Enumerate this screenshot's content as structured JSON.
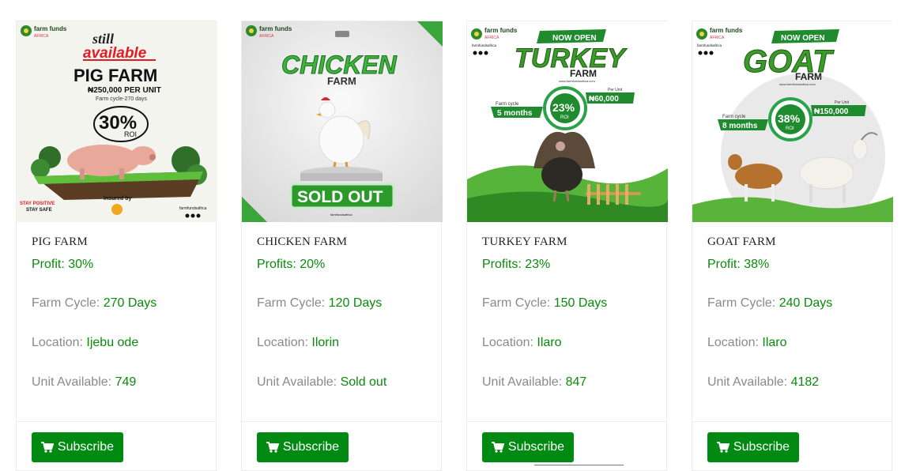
{
  "cards": [
    {
      "title": "PIG FARM",
      "profit": "Profit: 30%",
      "cycle_label": "Farm Cycle:",
      "cycle_value": "270 Days",
      "location_label": "Location:",
      "location_value": "Ijebu ode",
      "unit_label": "Unit Available:",
      "unit_value": "749",
      "button": "Subscribe",
      "banner": {
        "brand": "farm funds",
        "brand_sub": "AFRICA",
        "tag1": "still",
        "tag2": "available",
        "headline": "PIG FARM",
        "price": "₦250,000 PER UNIT",
        "cycle": "Farm cycle-270 days",
        "roi": "30%",
        "roi_sub": "ROI",
        "insured": "Insured by",
        "stay1": "STAY POSITIVE",
        "stay2": "STAY SAFE",
        "handle": "farmfundsafrica"
      }
    },
    {
      "title": "CHICKEN FARM",
      "profit": "Profits: 20%",
      "cycle_label": "Farm Cycle:",
      "cycle_value": "120 Days",
      "location_label": "Location:",
      "location_value": "Ilorin",
      "unit_label": "Unit Available:",
      "unit_value": "Sold out",
      "button": "Subscribe",
      "banner": {
        "brand": "farm funds",
        "brand_sub": "AFRICA",
        "headline": "CHICKEN",
        "sub": "FARM",
        "badge": "SOLD OUT",
        "handle": "farmfundsafrica"
      }
    },
    {
      "title": "TURKEY FARM",
      "profit": "Profits: 23%",
      "cycle_label": "Farm Cycle:",
      "cycle_value": "150 Days",
      "location_label": "Location:",
      "location_value": "Ilaro",
      "unit_label": "Unit Available:",
      "unit_value": "847",
      "button": "Subscribe",
      "banner": {
        "brand": "farm funds",
        "brand_sub": "AFRICA",
        "handle": "farmfundsafrica",
        "ribbon": "NOW OPEN",
        "headline": "TURKEY",
        "sub": "FARM",
        "url": "www.farmfundsafrica.com",
        "cycle_small": "Farm cycle",
        "cycle": "5 months",
        "roi": "23%",
        "roi_sub": "ROI",
        "price_small": "Per Unit",
        "price": "₦60,000"
      }
    },
    {
      "title": "GOAT FARM",
      "profit": "Profit: 38%",
      "cycle_label": "Farm Cycle:",
      "cycle_value": "240 Days",
      "location_label": "Location:",
      "location_value": "Ilaro",
      "unit_label": "Unit Available:",
      "unit_value": "4182",
      "button": "Subscribe",
      "banner": {
        "brand": "farm funds",
        "brand_sub": "AFRICA",
        "handle": "farmfundsafrica",
        "ribbon": "NOW OPEN",
        "headline": "GOAT",
        "sub": "FARM",
        "url": "www.farmfundsafrica.com",
        "cycle_small": "Farm cycle",
        "cycle": "8 months",
        "roi": "38%",
        "roi_sub": "ROI",
        "price_small": "Per Unit",
        "price": "₦150,000"
      }
    }
  ],
  "colors": {
    "accent_green": "#008a12",
    "value_green": "#0a8a0a",
    "label_gray": "#8a8a8a"
  },
  "icons": {
    "button_icon": "shopping-cart-icon"
  }
}
